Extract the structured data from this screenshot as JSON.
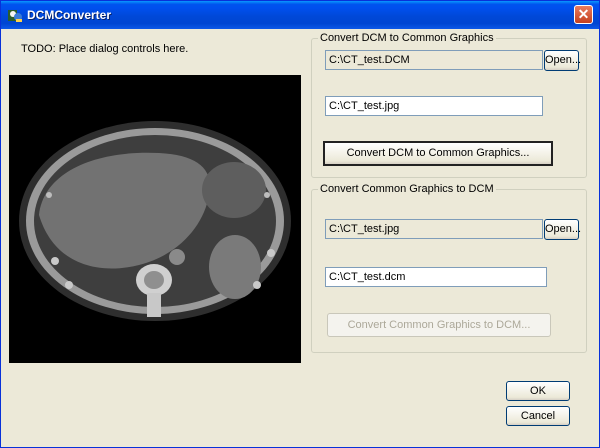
{
  "window": {
    "title": "DCMConverter"
  },
  "todo_text": "TODO: Place dialog controls here.",
  "group1": {
    "label": "Convert DCM to Common Graphics",
    "source_path": "C:\\CT_test.DCM",
    "open_label": "Open...",
    "dest_path": "C:\\CT_test.jpg",
    "convert_label": "Convert DCM to Common Graphics..."
  },
  "group2": {
    "label": "Convert Common Graphics to DCM",
    "source_path": "C:\\CT_test.jpg",
    "open_label": "Open...",
    "dest_path": "C:\\CT_test.dcm",
    "convert_label": "Convert Common Graphics to DCM..."
  },
  "ok_label": "OK",
  "cancel_label": "Cancel"
}
